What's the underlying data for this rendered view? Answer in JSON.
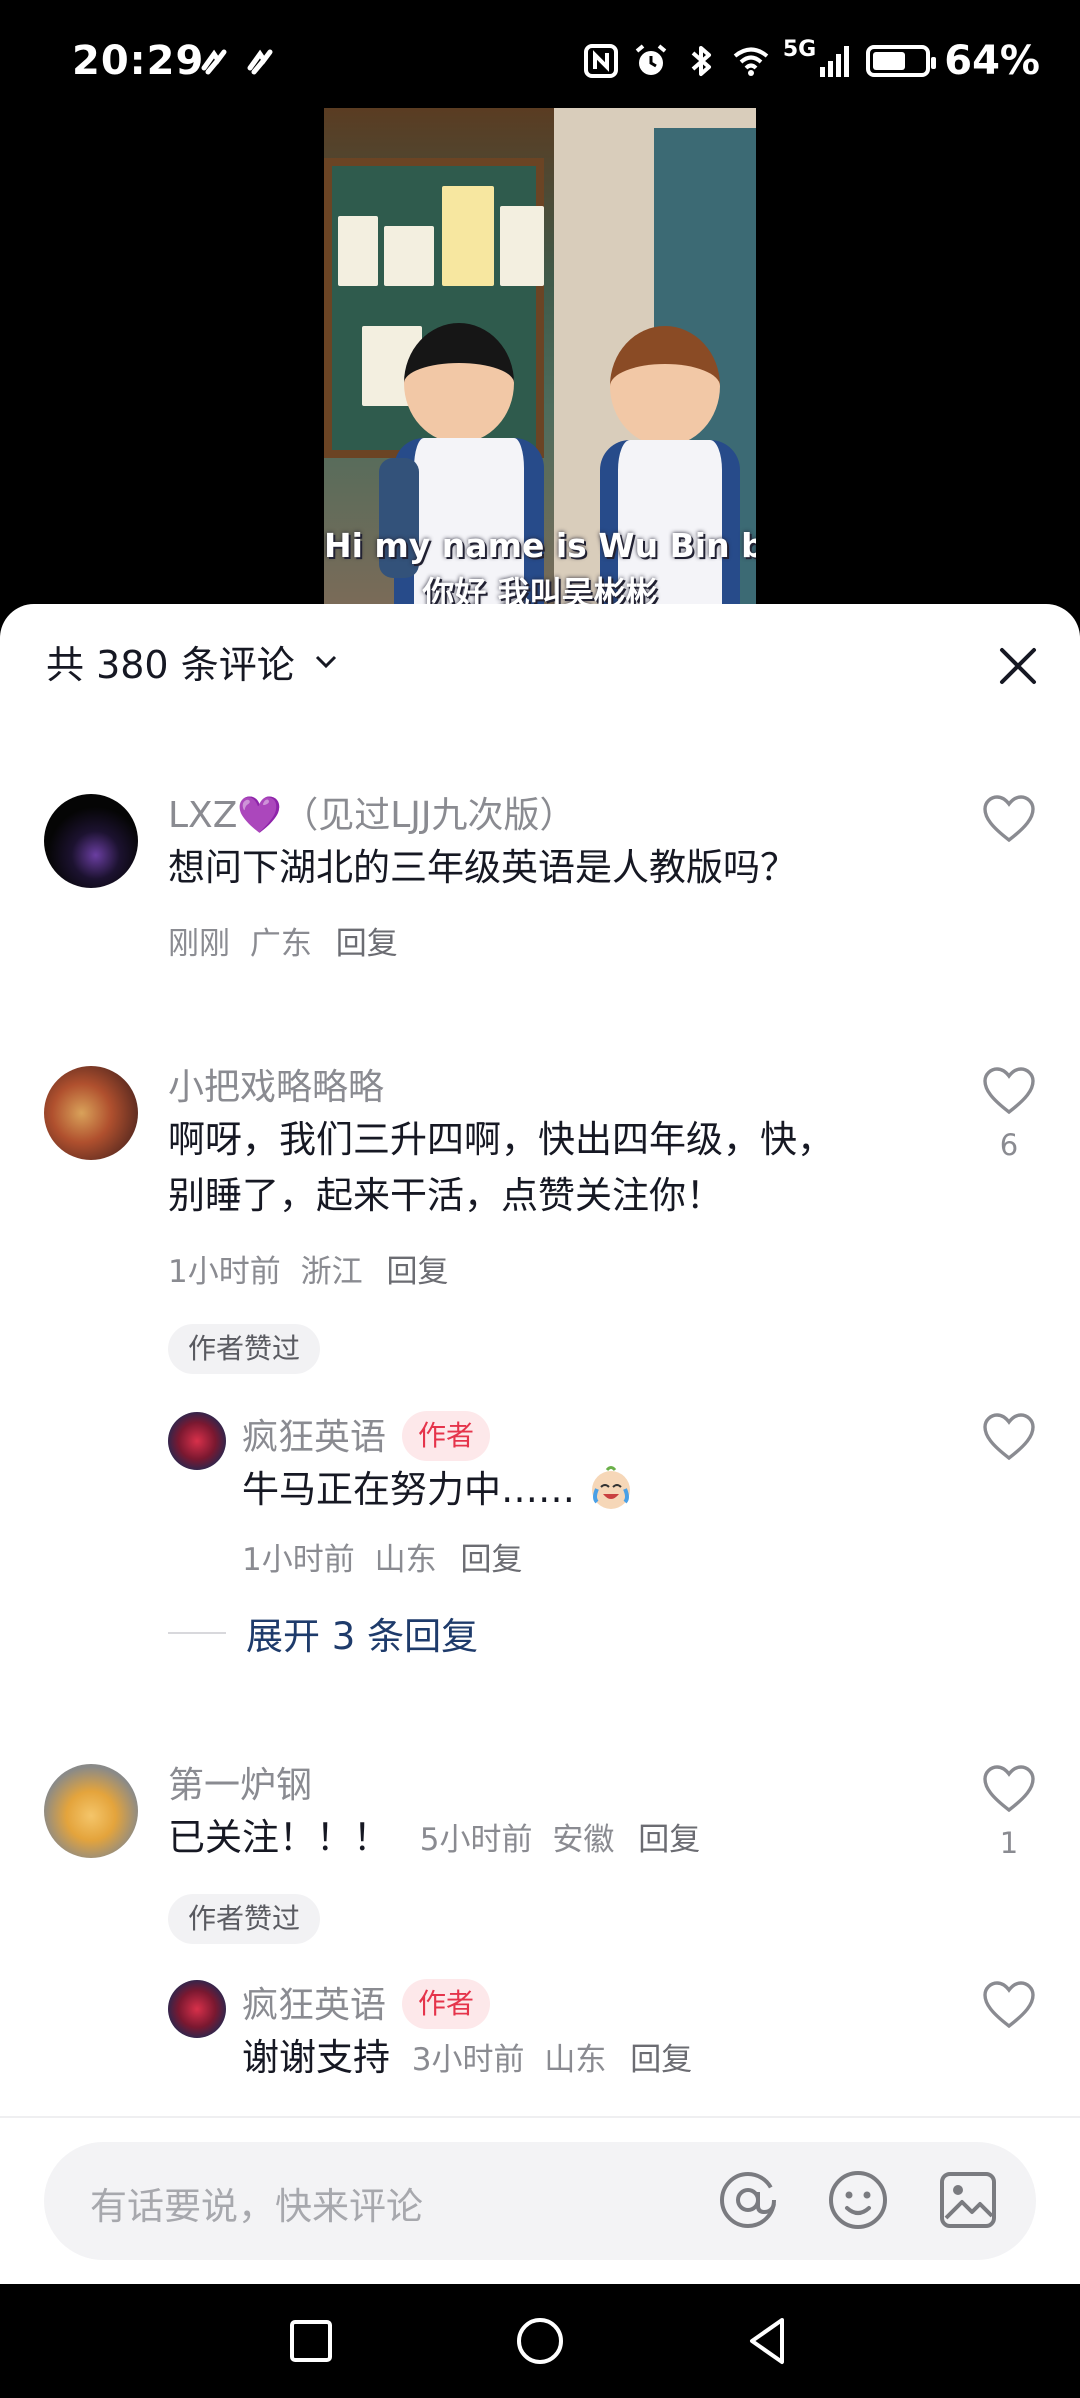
{
  "status_bar": {
    "time": "20:29",
    "network": "5G",
    "battery_percent": "64%",
    "battery_level": 0.64,
    "icons": [
      "nfc-icon",
      "alarm-icon",
      "bluetooth-icon",
      "wifi-icon",
      "signal-icon",
      "battery-icon"
    ]
  },
  "video": {
    "subtitle_en": "Hi  my name is Wu Bin bin",
    "subtitle_zh": "你好 我叫吴彬彬"
  },
  "header": {
    "title": "共 380 条评论"
  },
  "comments": [
    {
      "username": "LXZ💜（见过LJJ九次版）",
      "text": "想问下湖北的三年级英语是人教版吗？",
      "time": "刚刚",
      "location": "广东",
      "reply_label": "回复",
      "likes": ""
    },
    {
      "username": "小把戏略略略",
      "text_line1": "啊呀，我们三升四啊，快出四年级，快，",
      "text_line2": "别睡了，起来干活，点赞关注你！",
      "time": "1小时前",
      "location": "浙江",
      "reply_label": "回复",
      "likes": "6",
      "badge": "作者赞过",
      "reply": {
        "username": "疯狂英语",
        "author_tag": "作者",
        "text": "牛马正在努力中……",
        "time": "1小时前",
        "location": "山东",
        "reply_label": "回复"
      },
      "expand_label": "展开 3 条回复"
    },
    {
      "username": "第一炉钢",
      "text": "已关注！！！",
      "time": "5小时前",
      "location": "安徽",
      "reply_label": "回复",
      "likes": "1",
      "badge": "作者赞过",
      "reply": {
        "username": "疯狂英语",
        "author_tag": "作者",
        "text": "谢谢支持",
        "time": "3小时前",
        "location": "山东",
        "reply_label": "回复"
      }
    }
  ],
  "input": {
    "placeholder": "有话要说，快来评论"
  },
  "colors": {
    "author_tag_bg": "#fde8ea",
    "author_tag_text": "#e5344b",
    "expand_link": "#1e3b6b"
  }
}
